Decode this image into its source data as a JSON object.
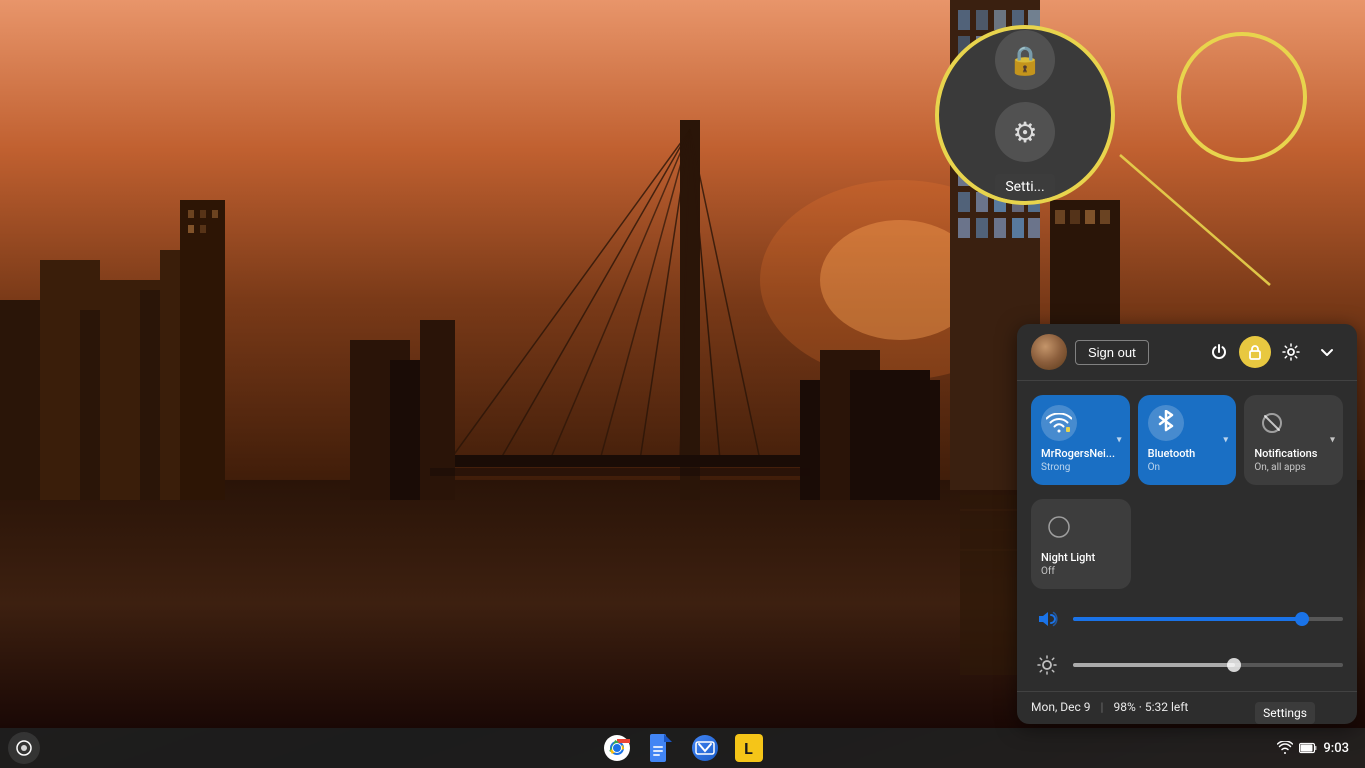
{
  "desktop": {
    "background_description": "Rotterdam cityscape at sunset with water reflection"
  },
  "taskbar": {
    "launcher_label": "Launcher",
    "apps": [
      {
        "name": "Chrome",
        "icon": "chrome-icon"
      },
      {
        "name": "Google Docs",
        "icon": "docs-icon"
      },
      {
        "name": "Messages",
        "icon": "messages-icon"
      },
      {
        "name": "Lexi",
        "icon": "lexi-icon"
      }
    ],
    "clock": "9:03",
    "wifi_signal": "strong",
    "battery": "98%"
  },
  "quick_settings": {
    "sign_out_label": "Sign out",
    "header_icons": [
      {
        "name": "power-icon",
        "symbol": "⏻"
      },
      {
        "name": "lock-icon",
        "symbol": "🔒"
      },
      {
        "name": "settings-icon",
        "symbol": "⚙"
      },
      {
        "name": "collapse-icon",
        "symbol": "⌄"
      }
    ],
    "tiles": [
      {
        "name": "wifi-tile",
        "icon": "wifi",
        "label": "MrRogersNei...",
        "status": "Strong",
        "active": true,
        "has_dropdown": true
      },
      {
        "name": "bluetooth-tile",
        "icon": "bluetooth",
        "label": "Bluetooth",
        "status": "On",
        "active": true,
        "has_dropdown": true
      },
      {
        "name": "notifications-tile",
        "icon": "notifications",
        "label": "Notifications",
        "status": "On, all apps",
        "active": false,
        "has_dropdown": true
      }
    ],
    "tiles_row2": [
      {
        "name": "night-light-tile",
        "icon": "night-light",
        "label": "Night Light",
        "status": "Off",
        "active": false
      }
    ],
    "sliders": [
      {
        "name": "volume-slider",
        "icon": "volume",
        "value": 85,
        "symbol": "🔊"
      },
      {
        "name": "brightness-slider",
        "icon": "brightness",
        "value": 60,
        "symbol": "⚙"
      }
    ],
    "footer": {
      "date": "Mon, Dec 9",
      "battery_text": "98% · 5:32 left"
    }
  },
  "tooltips": {
    "settings": "Settings"
  },
  "zoom": {
    "lock_symbol": "🔒",
    "settings_symbol": "⚙",
    "settings_label": "Setti..."
  }
}
